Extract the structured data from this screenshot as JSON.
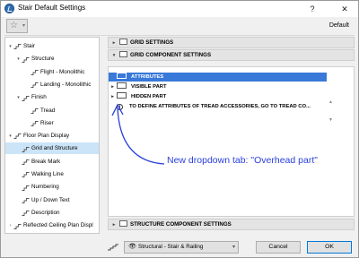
{
  "window": {
    "title": "Stair Default Settings",
    "help": "?",
    "close": "✕"
  },
  "toolbar": {
    "favorites_icon": "☆",
    "default_label": "Default"
  },
  "tree": {
    "items": [
      {
        "label": "Stair",
        "level": 0,
        "toggle": "▾",
        "icon": "stair-icon"
      },
      {
        "label": "Structure",
        "level": 1,
        "toggle": "▾",
        "icon": "structure-icon"
      },
      {
        "label": "Flight - Monolithic",
        "level": 2,
        "toggle": "",
        "icon": "flight-icon"
      },
      {
        "label": "Landing - Monolithic",
        "level": 2,
        "toggle": "",
        "icon": "landing-icon"
      },
      {
        "label": "Finish",
        "level": 1,
        "toggle": "▾",
        "icon": "finish-icon"
      },
      {
        "label": "Tread",
        "level": 2,
        "toggle": "",
        "icon": "tread-icon"
      },
      {
        "label": "Riser",
        "level": 2,
        "toggle": "",
        "icon": "riser-icon"
      },
      {
        "label": "Floor Plan Display",
        "level": 0,
        "toggle": "▾",
        "icon": "floor-plan-icon"
      },
      {
        "label": "Grid and Structure",
        "level": 1,
        "toggle": "",
        "icon": "grid-icon",
        "selected": true
      },
      {
        "label": "Break Mark",
        "level": 1,
        "toggle": "",
        "icon": "break-mark-icon"
      },
      {
        "label": "Walking Line",
        "level": 1,
        "toggle": "",
        "icon": "walking-line-icon"
      },
      {
        "label": "Numbering",
        "level": 1,
        "toggle": "",
        "icon": "numbering-icon"
      },
      {
        "label": "Up / Down Text",
        "level": 1,
        "toggle": "",
        "icon": "up-down-text-icon"
      },
      {
        "label": "Description",
        "level": 1,
        "toggle": "",
        "icon": "description-icon"
      },
      {
        "label": "Reflected Ceiling Plan Displ",
        "level": 0,
        "toggle": "›",
        "icon": "ceiling-plan-icon"
      }
    ]
  },
  "panel": {
    "grid_settings": "GRID SETTINGS",
    "grid_component_settings": "GRID COMPONENT SETTINGS",
    "rows": [
      {
        "label": "ATTRIBUTES",
        "toggle": "",
        "selected": true
      },
      {
        "label": "VISIBLE PART",
        "toggle": "▸"
      },
      {
        "label": "HIDDEN PART",
        "toggle": "▸"
      },
      {
        "label": "TO DEFINE ATTRIBUTES OF TREAD ACCESSORIES, GO TO TREAD CO...",
        "toggle": "",
        "info": true
      }
    ],
    "structure_component_settings": "STRUCTURE COMPONENT SETTINGS"
  },
  "annotation": "New dropdown tab: \"Overhead part\"",
  "footer": {
    "view_select": "Structural - Stair & Railing",
    "cancel": "Cancel",
    "ok": "OK"
  },
  "colors": {
    "selection": "#3879d9",
    "annotation": "#2a3fdc"
  }
}
